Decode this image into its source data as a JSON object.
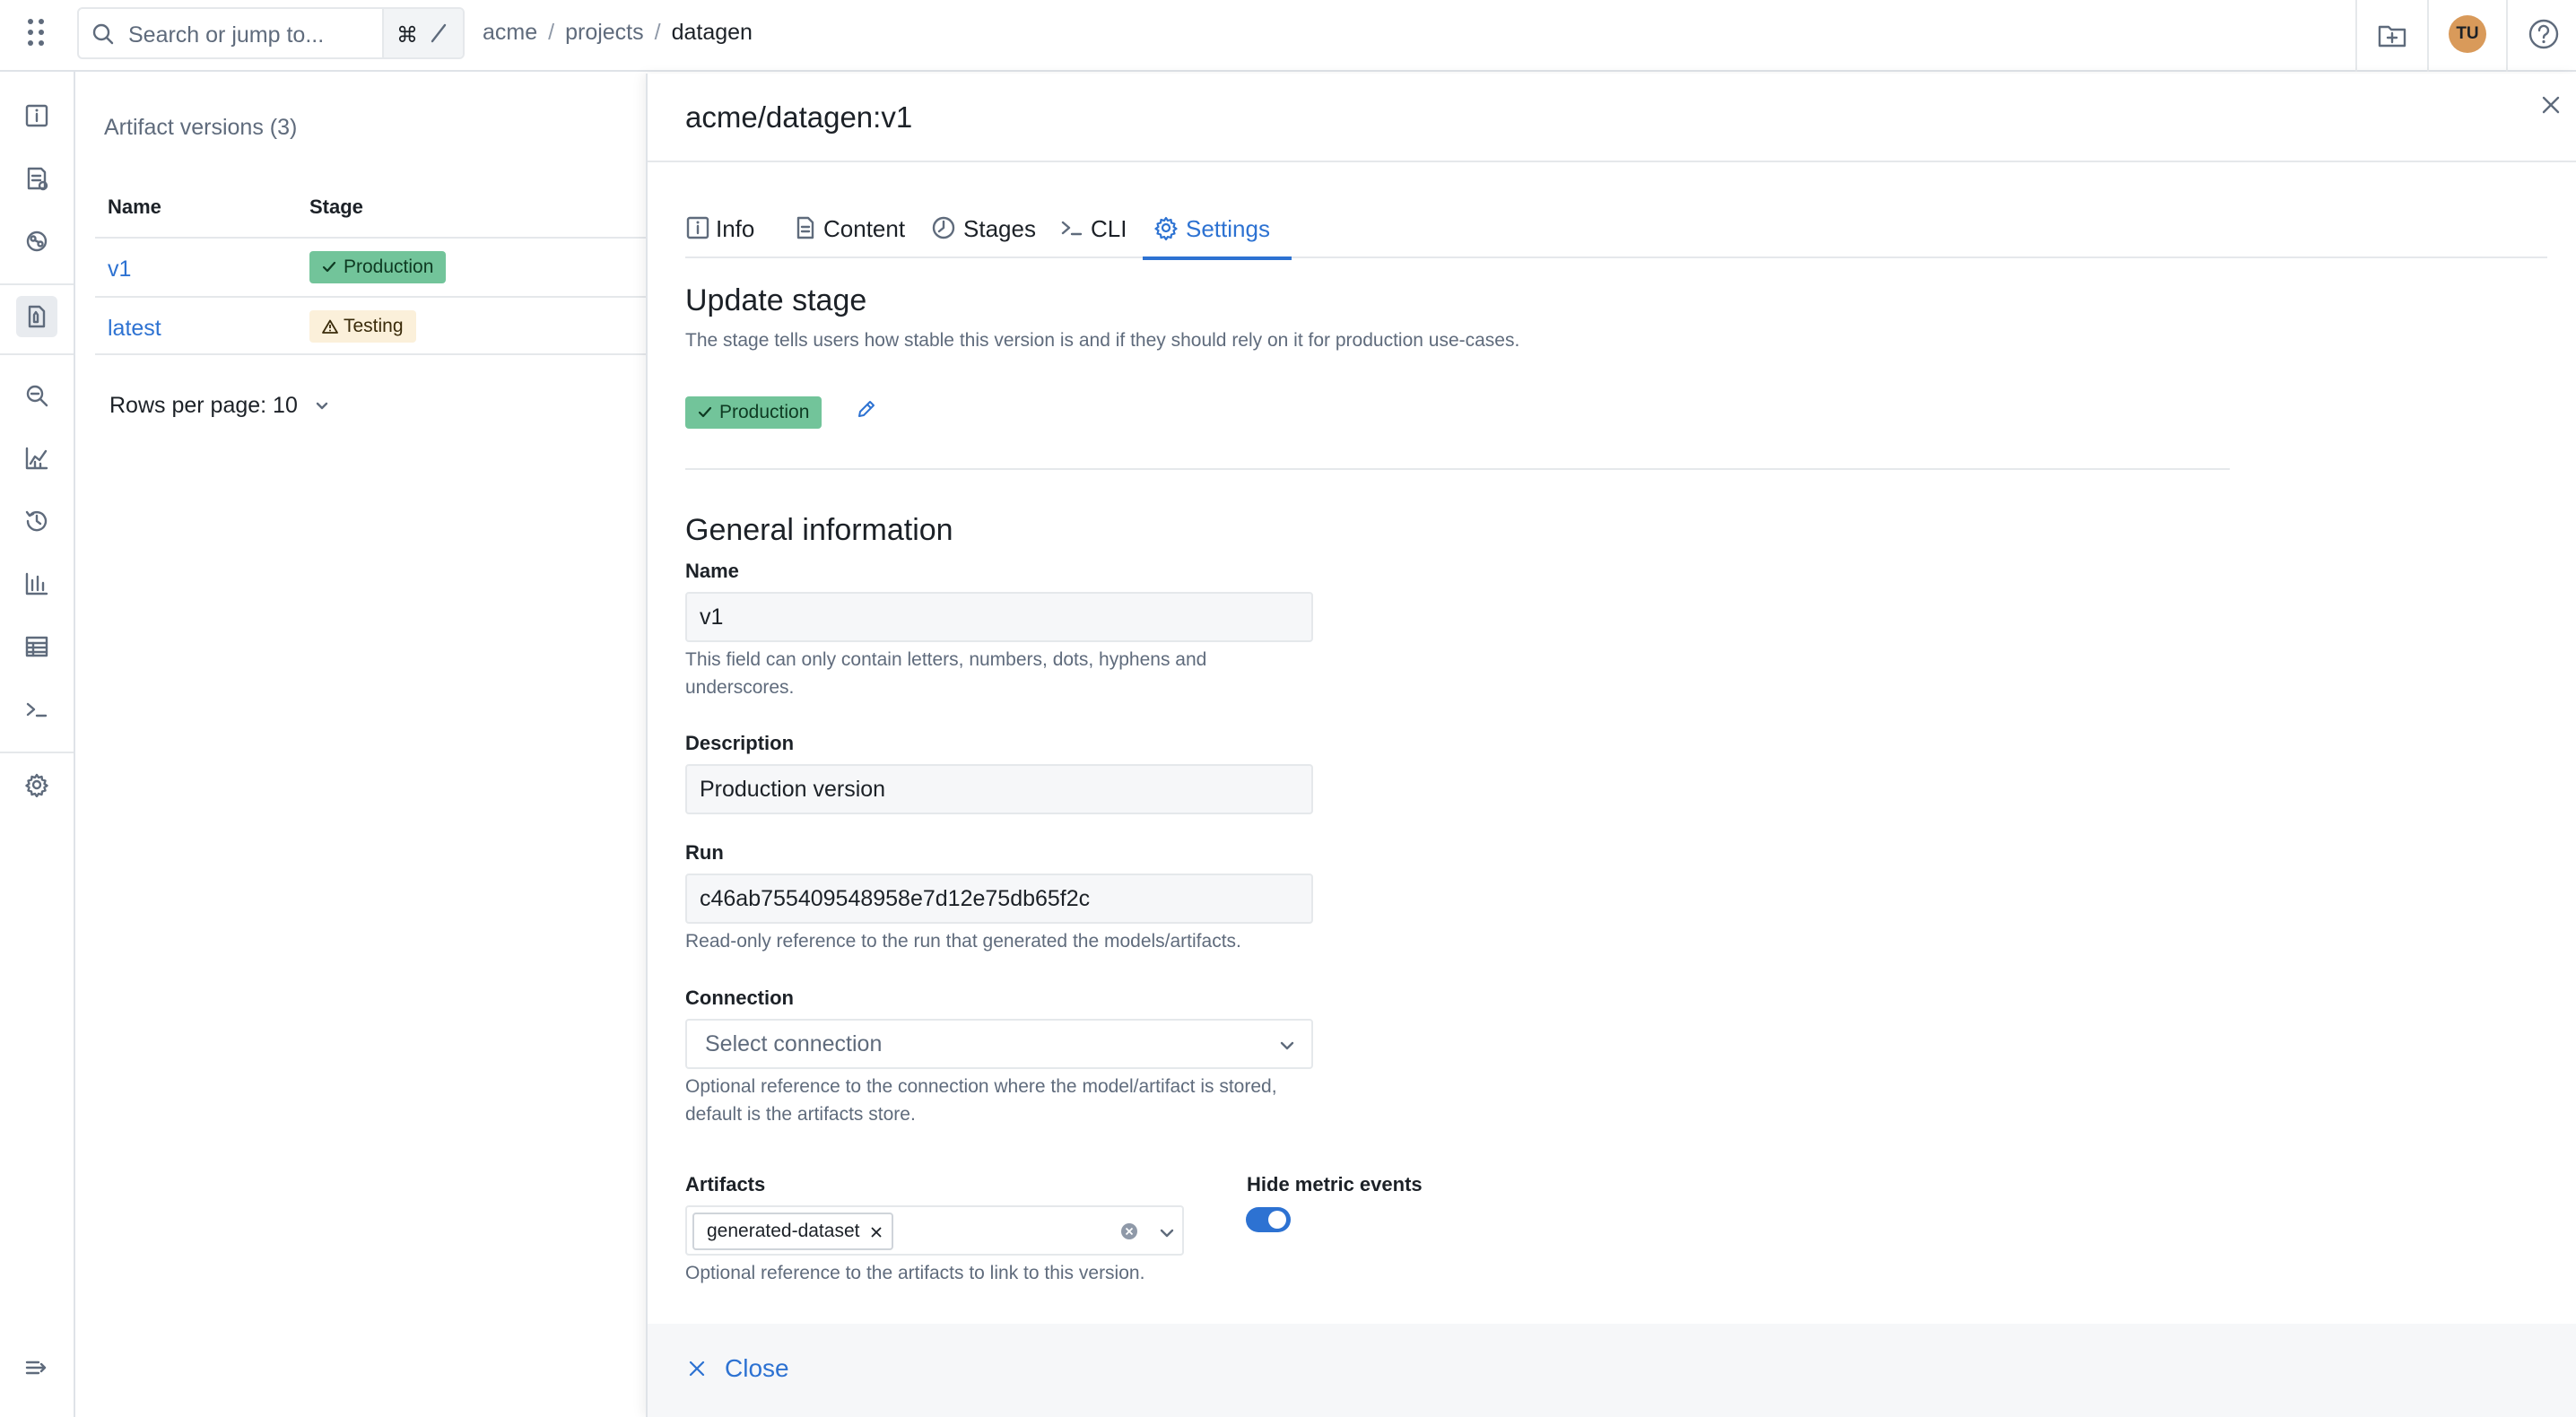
{
  "topbar": {
    "search_placeholder": "Search or jump to...",
    "shortcut_cmd": "⌘",
    "breadcrumb": [
      "acme",
      "projects",
      "datagen"
    ],
    "avatar_initials": "TU"
  },
  "left_nav": {
    "icons": [
      "info-icon",
      "runs-icon",
      "components-icon",
      "artifacts-icon",
      "search-icon",
      "metrics-icon",
      "history-icon",
      "chart-icon",
      "table-icon",
      "terminal-icon",
      "settings-icon",
      "expand-icon"
    ],
    "active": "artifacts-icon"
  },
  "versions_panel": {
    "title": "Artifact versions (3)",
    "columns": [
      "Name",
      "Stage"
    ],
    "rows": [
      {
        "name": "v1",
        "stage": "Production"
      },
      {
        "name": "latest",
        "stage": "Testing"
      }
    ],
    "rows_per_page": "Rows per page: 10"
  },
  "drawer": {
    "title": "acme/datagen:v1",
    "tabs": [
      {
        "label": "Info"
      },
      {
        "label": "Content"
      },
      {
        "label": "Stages"
      },
      {
        "label": "CLI"
      },
      {
        "label": "Settings"
      }
    ],
    "active_tab": "Settings",
    "update_stage": {
      "heading": "Update stage",
      "description": "The stage tells users how stable this version is and if they should rely on it for production use-cases.",
      "current_stage": "Production"
    },
    "general": {
      "heading": "General information",
      "name_label": "Name",
      "name_value": "v1",
      "name_help": "This field can only contain letters, numbers, dots, hyphens and underscores.",
      "description_label": "Description",
      "description_value": "Production version",
      "run_label": "Run",
      "run_value": "c46ab755409548958e7d12e75db65f2c",
      "run_help": "Read-only reference to the run that generated the models/artifacts.",
      "connection_label": "Connection",
      "connection_placeholder": "Select connection",
      "connection_help": "Optional reference to the connection where the model/artifact is stored, default is the artifacts store.",
      "artifacts_label": "Artifacts",
      "artifacts_selected": [
        "generated-dataset"
      ],
      "artifacts_help": "Optional reference to the artifacts to link to this version.",
      "hide_metric_label": "Hide metric events",
      "hide_metric_enabled": true
    },
    "footer_close": "Close"
  },
  "colors": {
    "accent": "#2d72d2",
    "production_badge": "#72c49a",
    "testing_badge": "#fbf0da",
    "avatar": "#d99a5a"
  }
}
